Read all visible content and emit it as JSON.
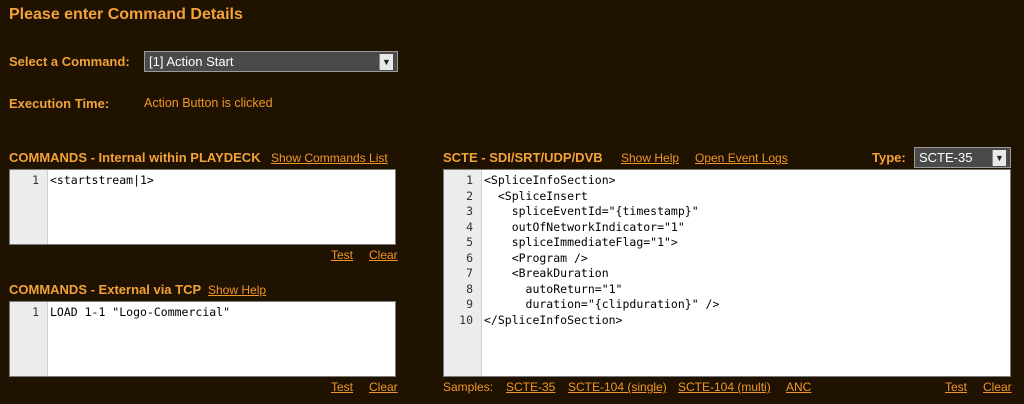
{
  "header": {
    "title": "Please enter Command Details"
  },
  "command": {
    "label": "Select a Command:",
    "selected": "[1] Action Start"
  },
  "execution": {
    "label": "Execution Time:",
    "value": "Action Button is clicked"
  },
  "internal": {
    "title": "COMMANDS - Internal within PLAYDECK",
    "show_list": "Show Commands List",
    "lines": [
      "<startstream|1>"
    ],
    "line_numbers": [
      "1"
    ],
    "test": "Test",
    "clear": "Clear"
  },
  "external": {
    "title": "COMMANDS - External via TCP",
    "show_help": "Show Help",
    "lines": [
      "LOAD 1-1 \"Logo-Commercial\""
    ],
    "line_numbers": [
      "1"
    ],
    "test": "Test",
    "clear": "Clear"
  },
  "scte": {
    "title": "SCTE - SDI/SRT/UDP/DVB",
    "show_help": "Show Help",
    "open_logs": "Open Event Logs",
    "type_label": "Type:",
    "type_selected": "SCTE-35",
    "line_numbers": [
      "1",
      "2",
      "3",
      "4",
      "5",
      "6",
      "7",
      "8",
      "9",
      "10"
    ],
    "lines": [
      "<SpliceInfoSection>",
      "  <SpliceInsert",
      "    spliceEventId=\"{timestamp}\"",
      "    outOfNetworkIndicator=\"1\"",
      "    spliceImmediateFlag=\"1\">",
      "    <Program />",
      "    <BreakDuration",
      "      autoReturn=\"1\"",
      "      duration=\"{clipduration}\" />",
      "</SpliceInfoSection>"
    ],
    "samples_label": "Samples:",
    "samples": [
      "SCTE-35",
      "SCTE-104 (single)",
      "SCTE-104 (multi)",
      "ANC"
    ],
    "test": "Test",
    "clear": "Clear"
  }
}
